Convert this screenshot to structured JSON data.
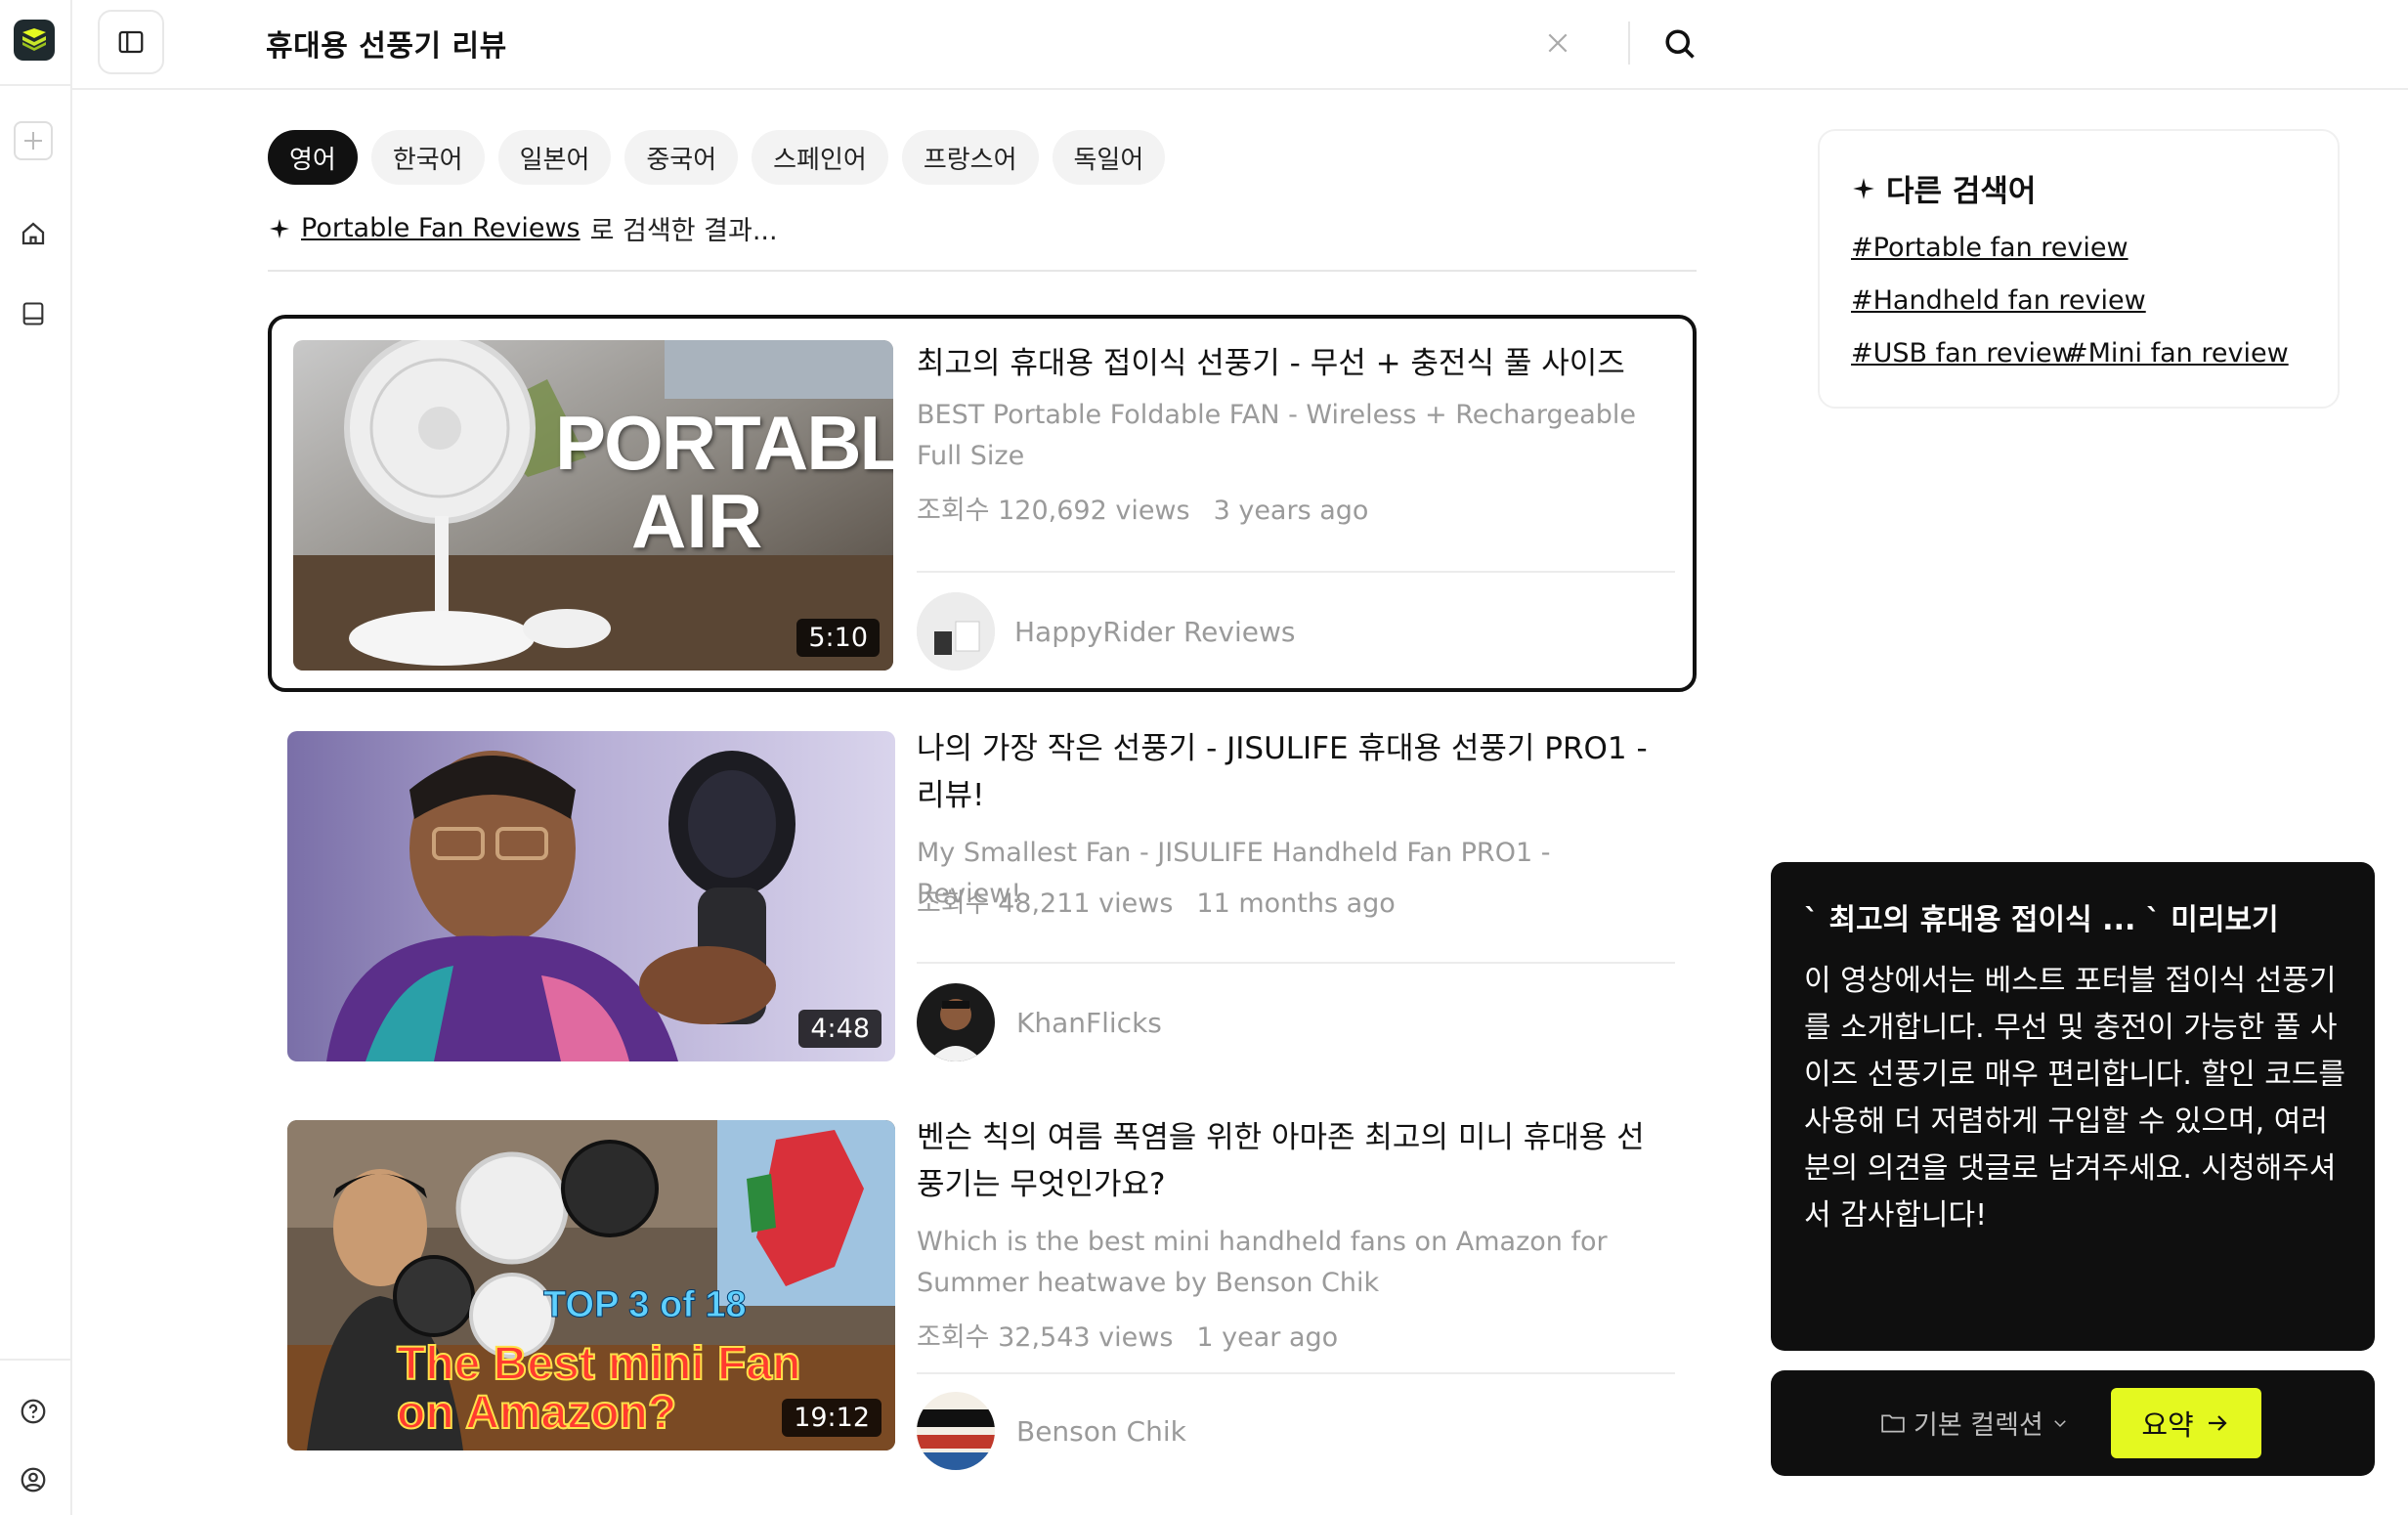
{
  "search": {
    "query": "휴대용 선풍기 리뷰"
  },
  "languages": [
    "영어",
    "한국어",
    "일본어",
    "중국어",
    "스페인어",
    "프랑스어",
    "독일어"
  ],
  "searched_for": {
    "query": "Portable Fan Reviews",
    "suffix": "로 검색한 결과..."
  },
  "results": [
    {
      "title": "최고의 휴대용 접이식 선풍기 - 무선 + 충전식 풀 사이즈",
      "subtitle": "BEST Portable Foldable FAN - Wireless + Rechargeable Full Size",
      "views": "조회수 120,692 views",
      "age": "3 years ago",
      "channel": "HappyRider Reviews",
      "duration": "5:10",
      "thumb_text_1": "PORTABLE",
      "thumb_text_2": "AIR"
    },
    {
      "title": "나의 가장 작은 선풍기 - JISULIFE 휴대용 선풍기 PRO1 - 리뷰!",
      "subtitle": "My Smallest Fan - JISULIFE Handheld Fan PRO1 - Review!",
      "views": "조회수 48,211 views",
      "age": "11 months ago",
      "channel": "KhanFlicks",
      "duration": "4:48"
    },
    {
      "title": "벤슨 칙의 여름 폭염을 위한 아마존 최고의 미니 휴대용 선풍기는 무엇인가요?",
      "subtitle": "Which is the best mini handheld fans on Amazon for Summer heatwave by Benson Chik",
      "views": "조회수 32,543 views",
      "age": "1 year ago",
      "channel": "Benson Chik",
      "duration": "19:12",
      "thumb_text_1": "TOP 3 of 18",
      "thumb_text_2": "The Best mini Fan",
      "thumb_text_3": "on Amazon?"
    }
  ],
  "related": {
    "title": "다른 검색어",
    "tags": [
      "#Portable fan review",
      "#Handheld fan review",
      "#USB fan review",
      "#Mini fan review"
    ]
  },
  "preview": {
    "title": "` 최고의 휴대용 접이식 ... ` 미리보기",
    "body": "이 영상에서는 베스트 포터블 접이식 선풍기를 소개합니다. 무선 및 충전이 가능한 풀 사이즈 선풍기로 매우 편리합니다. 할인 코드를 사용해 더 저렴하게 구입할 수 있으며, 여러분의 의견을 댓글로 남겨주세요. 시청해주셔서 감사합니다!"
  },
  "actions": {
    "collection": "기본 컬렉션",
    "summary": "요약"
  },
  "colors": {
    "accent": "#e4f920",
    "dark": "#0f0f0f"
  }
}
